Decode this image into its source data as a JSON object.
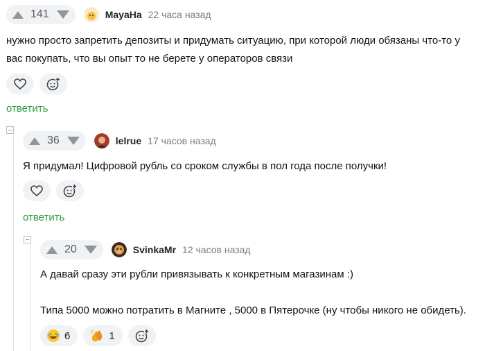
{
  "comments": [
    {
      "rating": "141",
      "author": "MayaHa",
      "time": "22 часа назад",
      "text": "нужно просто запретить депозиты и придумать ситуацию, при которой люди обязаны что-то у вас покупать, что вы опыт то не берете у операторов связи",
      "reply": "ответить"
    },
    {
      "rating": "36",
      "author": "lelrue",
      "time": "17 часов назад",
      "text": "Я придумал! Цифровой рубль со сроком службы в пол года после получки!",
      "reply": "ответить"
    },
    {
      "rating": "20",
      "author": "SvinkaMr",
      "time": "12 часов назад",
      "text_line1": "А давай сразу эти рубли привязывать к конкретным магазинам :)",
      "text_line2": "Типа 5000 можно потратить в Магните , 5000 в Пятерочке (ну чтобы никого не обидеть).",
      "reactions": [
        {
          "icon": "laughing-emoji-icon",
          "count": "6"
        },
        {
          "icon": "clapping-hands-icon",
          "count": "1"
        }
      ]
    }
  ],
  "colors": {
    "reply_link": "#2a9d3e",
    "pill_bg": "#f1f2f4",
    "muted": "#777e85"
  }
}
